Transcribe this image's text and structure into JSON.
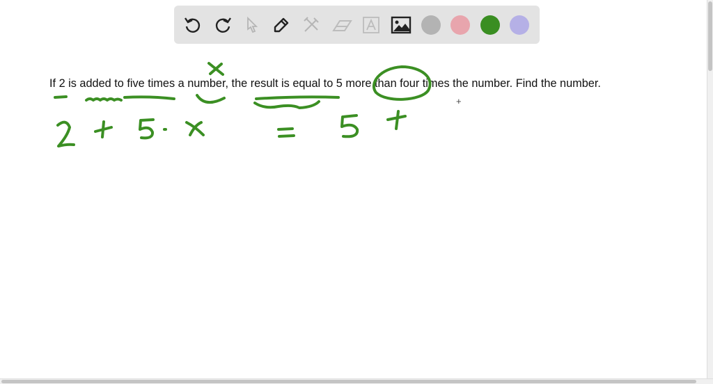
{
  "toolbar": {
    "tools": [
      "undo-icon",
      "redo-icon",
      "select-icon",
      "pen-icon",
      "tools-icon",
      "eraser-icon",
      "text-icon",
      "image-icon"
    ],
    "colors": [
      "#b3b3b3",
      "#e8a5ad",
      "#3a8e22",
      "#b5b0e6"
    ],
    "active_color": "#3a8e22"
  },
  "canvas": {
    "problem_text": "If 2 is added to five times a number, the result is equal to 5 more than four times the number. Find the number.",
    "ink_color": "#3b8f23"
  }
}
